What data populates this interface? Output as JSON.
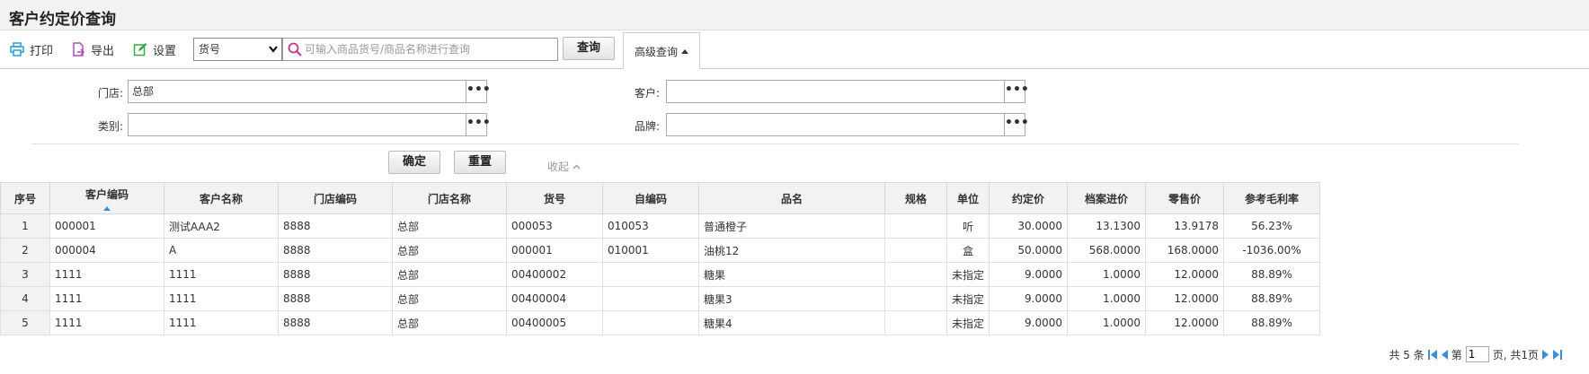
{
  "title": "客户约定价查询",
  "toolbar": {
    "print_label": "打印",
    "export_label": "导出",
    "settings_label": "设置",
    "field_select_value": "货号",
    "search_placeholder": "可输入商品货号/商品名称进行查询",
    "query_label": "查询",
    "advanced_label": "高级查询"
  },
  "filters": {
    "store_label": "门店:",
    "store_value": "总部",
    "customer_label": "客户:",
    "customer_value": "",
    "category_label": "类别:",
    "category_value": "",
    "brand_label": "品牌:",
    "brand_value": "",
    "more_glyph": "•••",
    "confirm_label": "确定",
    "reset_label": "重置",
    "collapse_label": "收起"
  },
  "table": {
    "columns": [
      "序号",
      "客户编码",
      "客户名称",
      "门店编码",
      "门店名称",
      "货号",
      "自编码",
      "品名",
      "规格",
      "单位",
      "约定价",
      "档案进价",
      "零售价",
      "参考毛利率"
    ],
    "rows": [
      [
        "1",
        "000001",
        "测试AAA2",
        "8888",
        "总部",
        "000053",
        "010053",
        "普通橙子",
        "",
        "听",
        "30.0000",
        "13.1300",
        "13.9178",
        "56.23%"
      ],
      [
        "2",
        "000004",
        "A",
        "8888",
        "总部",
        "000001",
        "010001",
        "油桃12",
        "",
        "盒",
        "50.0000",
        "568.0000",
        "168.0000",
        "-1036.00%"
      ],
      [
        "3",
        "1111",
        "1111",
        "8888",
        "总部",
        "00400002",
        "",
        "糖果",
        "",
        "未指定",
        "9.0000",
        "1.0000",
        "12.0000",
        "88.89%"
      ],
      [
        "4",
        "1111",
        "1111",
        "8888",
        "总部",
        "00400004",
        "",
        "糖果3",
        "",
        "未指定",
        "9.0000",
        "1.0000",
        "12.0000",
        "88.89%"
      ],
      [
        "5",
        "1111",
        "1111",
        "8888",
        "总部",
        "00400005",
        "",
        "糖果4",
        "",
        "未指定",
        "9.0000",
        "1.0000",
        "12.0000",
        "88.89%"
      ]
    ]
  },
  "pager": {
    "total_text": "共 5 条",
    "page_prefix": "第",
    "page_value": "1",
    "page_suffix": "页, 共1页"
  },
  "colors": {
    "print_icon": "#2a9bd6",
    "export_icon": "#b04ac0",
    "settings_icon": "#3aa64a",
    "search_icon": "#c0398a",
    "pager_icon": "#3a8fd8",
    "sort_arrow": "#3a8fd8"
  },
  "icons": [
    "printer-icon",
    "export-icon",
    "settings-icon",
    "magnifier-icon",
    "caret-up-icon",
    "chevron-up-icon",
    "first-page-icon",
    "prev-page-icon",
    "next-page-icon",
    "last-page-icon"
  ]
}
